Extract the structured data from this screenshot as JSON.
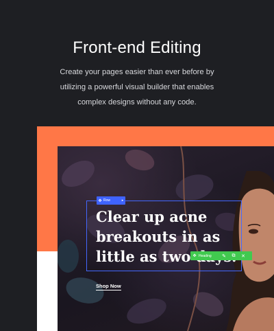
{
  "section": {
    "title": "Front-end Editing",
    "subtitle": "Create your pages easier than ever before by utilizing a powerful visual builder that enables complex designs without any code."
  },
  "preview": {
    "headline": "Clear up acne breakouts in as little as two days.",
    "cta_label": "Shop Now",
    "row_toolbar": {
      "label": "Row",
      "move_icon": "✥",
      "arrow_icon": "▸"
    },
    "heading_toolbar": {
      "label": "Heading",
      "move_icon": "✥",
      "edit_icon": "✎",
      "duplicate_icon": "⧉",
      "close_icon": "✕"
    }
  },
  "colors": {
    "background": "#1e1f23",
    "accent_orange": "#ff7747",
    "row_blue": "#3f63ff",
    "heading_green": "#41c94f"
  }
}
